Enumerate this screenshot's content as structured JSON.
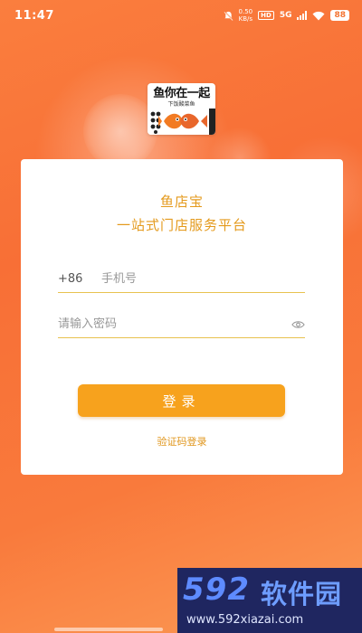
{
  "status_bar": {
    "time": "11:47",
    "net_speed_value": "0.50",
    "net_speed_unit": "KB/s",
    "hd_badge": "HD",
    "network": "5G",
    "battery": "88"
  },
  "logo": {
    "title": "鱼你在一起",
    "subtitle": "下饭酸菜鱼"
  },
  "card": {
    "title": "鱼店宝",
    "subtitle": "一站式门店服务平台"
  },
  "phone_field": {
    "country_code": "+86",
    "placeholder": "手机号",
    "value": ""
  },
  "password_field": {
    "placeholder": "请输入密码",
    "value": ""
  },
  "buttons": {
    "login_label": "登录",
    "sms_login_label": "验证码登录"
  },
  "watermark": {
    "number": "592",
    "name": "软件园",
    "url": "www.592xiazai.com"
  },
  "colors": {
    "background": "#f86f36",
    "accent": "#f7a21d",
    "text_accent": "#e49a1d"
  },
  "icons": {
    "password_toggle": "eye-icon"
  }
}
